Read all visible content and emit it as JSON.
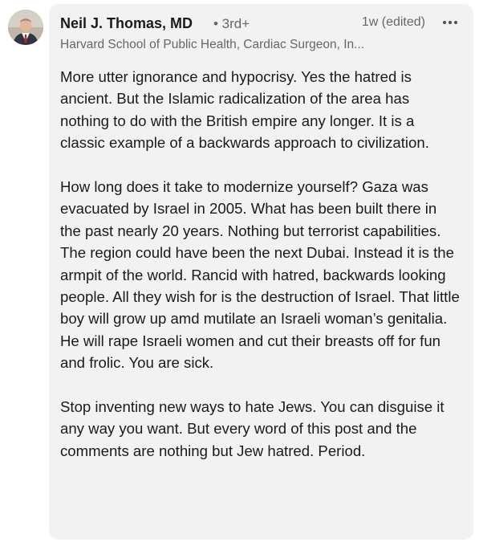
{
  "comment": {
    "author": {
      "name": "Neil J. Thomas, MD",
      "degree": "• 3rd+",
      "headline": "Harvard School of Public Health, Cardiac Surgeon, In..."
    },
    "timestamp": "1w (edited)",
    "more_icon": "more-horizontal-icon",
    "paragraphs": [
      "More utter ignorance and hypocrisy. Yes the hatred is ancient. But the Islamic radicalization of the area has nothing to do with the British empire any longer. It is a classic example of a backwards approach to civilization.",
      "How long does it take to modernize yourself? Gaza was evacuated by Israel in 2005. What has been built there in the past nearly 20 years. Nothing but terrorist capabilities. The region could have been the next Dubai. Instead it is the armpit of the world. Rancid with hatred, backwards looking people. All they wish for is the destruction of Israel. That little boy will grow up amd mutilate an Israeli woman’s genitalia. He will rape Israeli women and cut their breasts off for fun and frolic. You are sick.",
      "Stop inventing new ways to hate Jews. You can disguise it any way you want. But every word of this post and the comments are nothing but Jew hatred. Period."
    ]
  },
  "colors": {
    "bubble_background": "#f2f2f2",
    "primary_text": "#1a1a1a",
    "secondary_text": "#666666"
  }
}
